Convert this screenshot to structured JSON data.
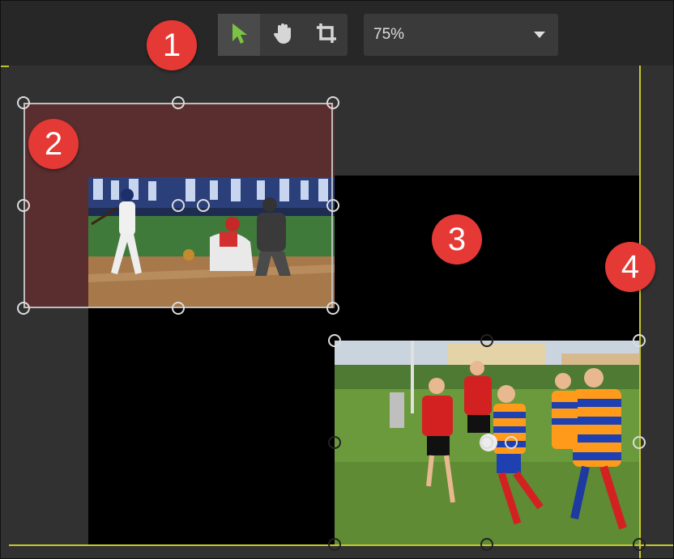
{
  "toolbar": {
    "tools": [
      {
        "name": "select-tool",
        "icon": "arrow-pointer-icon",
        "active": true
      },
      {
        "name": "pan-tool",
        "icon": "hand-icon",
        "active": false
      },
      {
        "name": "crop-tool",
        "icon": "crop-icon",
        "active": false
      }
    ],
    "zoom_value": "75%"
  },
  "annotations": {
    "badge_1": "1",
    "badge_2": "2",
    "badge_3": "3",
    "badge_4": "4"
  },
  "media": {
    "baseball_image": "baseball-batter-catcher-umpire-photo",
    "rugby_image": "rugby-players-running-photo"
  },
  "colors": {
    "guide_line": "#c7c72a",
    "badge": "#e53935",
    "active_tool": "#7cc243"
  }
}
